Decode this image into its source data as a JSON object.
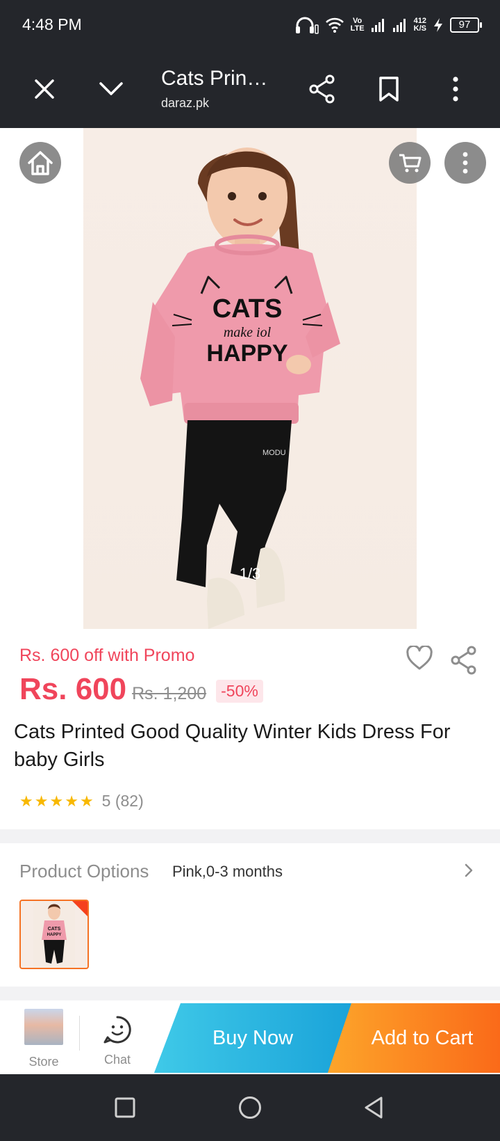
{
  "status_bar": {
    "time": "4:48 PM",
    "network_label": "Vo\nLTE",
    "speed": "412\nK/S",
    "battery": "97"
  },
  "toolbar": {
    "title": "Cats Prin…",
    "domain": "daraz.pk",
    "icons": [
      "close-icon",
      "chevron-down-icon",
      "share-icon",
      "bookmark-icon",
      "more-vertical-icon"
    ]
  },
  "gallery": {
    "counter": "1/3",
    "sweater_text_line1": "CATS",
    "sweater_text_line2": "make iol",
    "sweater_text_line3": "HAPPY"
  },
  "product": {
    "promo_text": "Rs. 600 off with Promo",
    "price": "Rs. 600",
    "original_price": "Rs. 1,200",
    "discount": "-50%",
    "title": "Cats Printed Good Quality Winter Kids Dress For baby Girls",
    "rating_stars": 5,
    "rating_text": "5 (82)"
  },
  "options": {
    "label": "Product Options",
    "selected": "Pink,0-3 months"
  },
  "actions": {
    "store_label": "Store",
    "chat_label": "Chat",
    "buy_now": "Buy Now",
    "add_to_cart": "Add to Cart"
  },
  "colors": {
    "accent_red": "#f0455b",
    "buy_now_blue": "#1aa3d9",
    "add_to_cart_orange": "#fa6a19",
    "rating_star": "#f8b800"
  }
}
